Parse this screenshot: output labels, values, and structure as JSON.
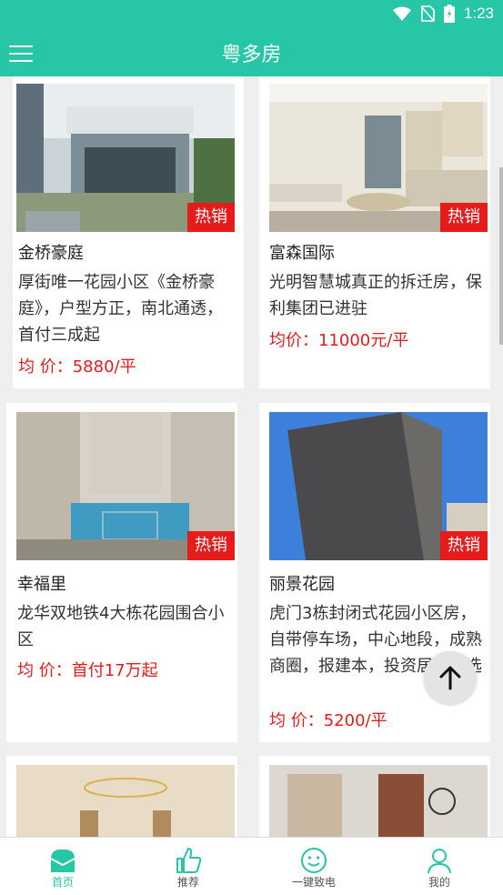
{
  "status": {
    "time": "1:23"
  },
  "app": {
    "title": "粤多房"
  },
  "listings": [
    {
      "name": "金桥豪庭",
      "desc": "厚街唯一花园小区《金桥豪庭》，户型方正，南北通透，首付三成起",
      "price": "均 价：5880/平",
      "tag": "热销"
    },
    {
      "name": "富森国际",
      "desc": "光明智慧城真正的拆迁房，保利集团已进驻",
      "price": "均价：11000元/平",
      "tag": "热销"
    },
    {
      "name": "幸福里",
      "desc": "龙华双地铁4大栋花园围合小区",
      "price": "均 价：首付17万起",
      "tag": "热销"
    },
    {
      "name": "丽景花园",
      "desc": "虎门3栋封闭式花园小区房，自带停车场，中心地段，成熟商圈，报建本，投资居家首选",
      "price": "均 价：5200/平",
      "tag": "热销"
    }
  ],
  "nav": [
    {
      "label": "首页",
      "icon": "home-icon"
    },
    {
      "label": "推荐",
      "icon": "thumbs-up-icon"
    },
    {
      "label": "一键致电",
      "icon": "smiley-icon"
    },
    {
      "label": "我的",
      "icon": "user-icon"
    }
  ],
  "colors": {
    "accent": "#26c6a6",
    "hot": "#e61b1b"
  }
}
